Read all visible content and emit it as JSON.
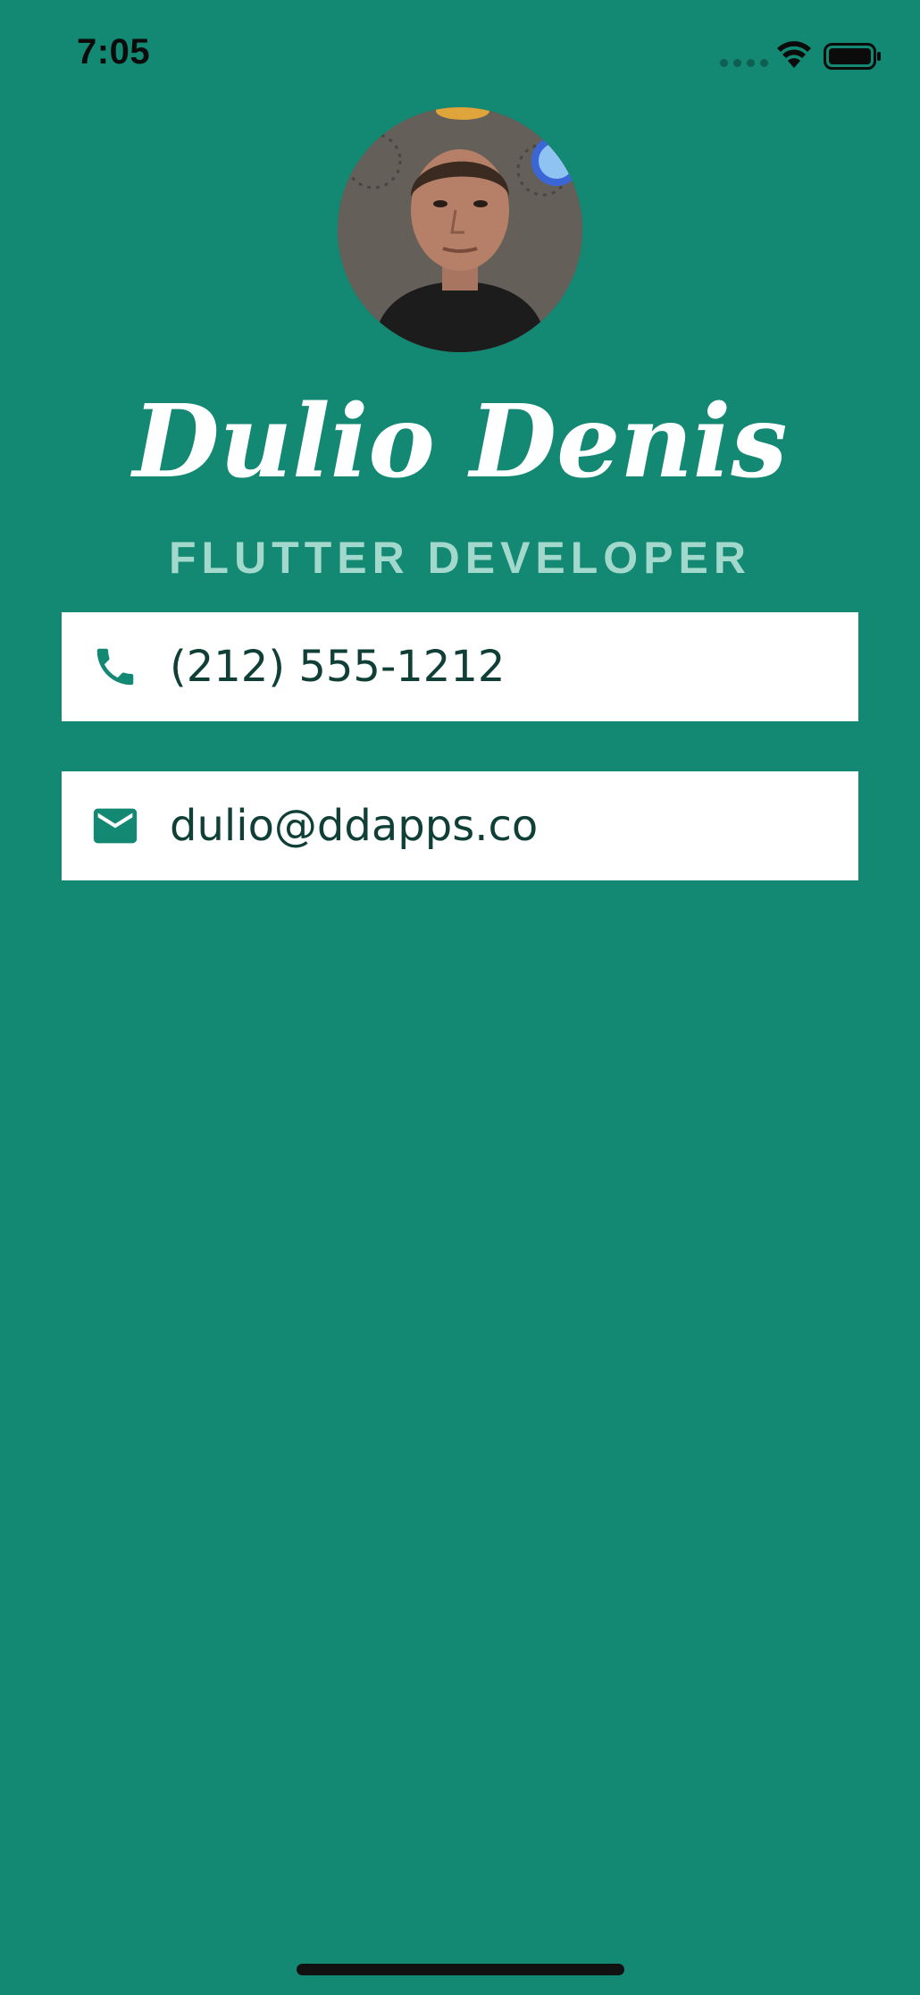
{
  "status_bar": {
    "time": "7:05"
  },
  "profile": {
    "name": "Dulio Denis",
    "role": "FLUTTER DEVELOPER"
  },
  "contacts": {
    "phone": "(212) 555-1212",
    "email": "dulio@ddapps.co"
  },
  "icons": {
    "phone": "phone-icon",
    "email": "mail-icon",
    "wifi": "wifi-icon",
    "battery": "battery-icon"
  },
  "colors": {
    "background": "#138873",
    "card": "#ffffff",
    "card_text": "#0f3f36",
    "role_text": "#a3d8cc",
    "icon": "#138873"
  }
}
